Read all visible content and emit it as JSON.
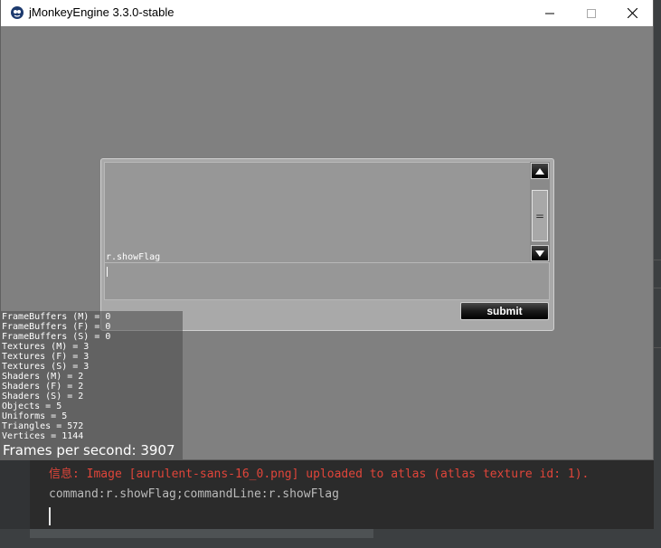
{
  "window": {
    "title": "jMonkeyEngine 3.3.0-stable",
    "controls": {
      "minimize": "minimize",
      "maximize": "maximize",
      "close": "close"
    }
  },
  "console": {
    "output_lines": [
      "r.showFlag"
    ],
    "input_value": "",
    "submit_label": "submit",
    "scrollbar": {
      "thumb_grip": "="
    }
  },
  "stats": {
    "lines": [
      "FrameBuffers (M) = 0",
      "FrameBuffers (F) = 0",
      "FrameBuffers (S) = 0",
      "Textures (M) = 3",
      "Textures (F) = 3",
      "Textures (S) = 3",
      "Shaders (M) = 2",
      "Shaders (F) = 2",
      "Shaders (S) = 2",
      "Objects = 5",
      "Uniforms = 5",
      "Triangles = 572",
      "Vertices = 1144"
    ],
    "fps": "Frames per second: 3907"
  },
  "ide_log": {
    "lines": [
      "信息: Image [aurulent-sans-16_0.png] uploaded to atlas (atlas texture id: 1).",
      "command:r.showFlag;commandLine:r.showFlag"
    ],
    "colors": {
      "info": "#e0453a",
      "normal": "#bbbbbb"
    }
  }
}
